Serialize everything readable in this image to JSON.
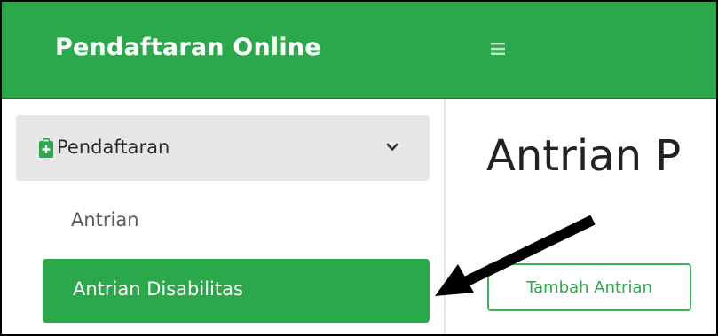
{
  "header": {
    "brand": "Pendaftaran Online",
    "menu_icon": "hamburger-icon"
  },
  "sidebar": {
    "group": {
      "label": "Pendaftaran",
      "icon": "clipboard-plus-icon",
      "chevron": "chevron-down-icon"
    },
    "items": [
      {
        "label": "Antrian",
        "active": false
      },
      {
        "label": "Antrian Disabilitas",
        "active": true
      }
    ]
  },
  "main": {
    "title": "Antrian P",
    "add_button_label": "Tambah Antrian"
  },
  "colors": {
    "brand_green": "#2ba84a",
    "sidebar_group_bg": "#e6e6e6",
    "annotation_arrow": "#000000"
  }
}
